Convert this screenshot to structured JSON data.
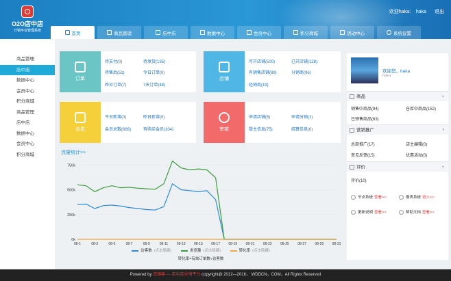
{
  "header": {
    "logo_title": "O2O店中店",
    "logo_subtitle": "分销平台管理系统",
    "welcome": "欢迎haka:",
    "username": "haka",
    "logout": "退出",
    "tabs": [
      {
        "label": "首页",
        "active": true
      },
      {
        "label": "商品管理"
      },
      {
        "label": "店中店"
      },
      {
        "label": "数据中心"
      },
      {
        "label": "会员中心"
      },
      {
        "label": "积分商城"
      },
      {
        "label": "活动中心"
      },
      {
        "label": "系统设置"
      }
    ]
  },
  "sidebar": {
    "items": [
      {
        "label": "商品管理"
      },
      {
        "label": "店中店",
        "active": true
      },
      {
        "label": "数据中心"
      },
      {
        "label": "会员中心"
      },
      {
        "label": "积分商城"
      },
      {
        "label": "商品管理"
      },
      {
        "label": "店中店"
      },
      {
        "label": "数据中心"
      },
      {
        "label": "会员中心"
      },
      {
        "label": "积分商城"
      }
    ]
  },
  "cards": {
    "order": {
      "title": "订单",
      "color": "#6ac5c4",
      "links": [
        "待支付(0)",
        "待发货(135)",
        "待售后(51)",
        "今日订单(0)",
        "昨日订单(7)",
        "7天订单(48)"
      ]
    },
    "store": {
      "title": "店铺",
      "color": "#4fb6e5",
      "links": [
        "可开店铺(500)",
        "已开店铺(128)",
        "有销售店铺(89)",
        "分销商(96)",
        "经销商(19)"
      ]
    },
    "member": {
      "title": "会员",
      "color": "#f5d03a",
      "links": [
        "今日新增(0)",
        "昨日新增(0)",
        "会员总数(666)",
        "有购买会员(104)"
      ]
    },
    "audit": {
      "title": "审核",
      "color": "#f26a6a",
      "links": [
        "申请店铺(5)",
        "申请分销(1)",
        "提主信息(75)",
        "结算信息(0)"
      ]
    }
  },
  "chart": {
    "section_title": "流量统计>>",
    "legend": [
      {
        "name": "访客数",
        "hint": "(点击隐藏)",
        "color": "#2a8bd6"
      },
      {
        "name": "浏览量",
        "hint": "(点击隐藏)",
        "color": "#3a9b3a"
      },
      {
        "name": "转化率",
        "hint": "(点击隐藏)",
        "color": "#f2a93b"
      }
    ],
    "formula": "转化率=有效订单数÷访客数"
  },
  "chart_data": {
    "type": "line",
    "ylim": [
      0,
      800000
    ],
    "y_ticks": [
      "0k",
      "250k",
      "500k",
      "750k"
    ],
    "x_ticks": [
      "08-1",
      "08-3",
      "08-5",
      "08-7",
      "08-9",
      "08-11",
      "08-13",
      "08-15",
      "08-17",
      "08-19",
      "08-21",
      "08-23",
      "08-25",
      "08-27",
      "08-29",
      "08-31"
    ],
    "series": [
      {
        "name": "访客数",
        "values": [
          350000,
          355000,
          310000,
          340000,
          345000,
          335000,
          320000,
          310000,
          300000,
          295000,
          330000,
          560000,
          500000,
          490000,
          480000,
          490000,
          400000,
          0,
          0,
          0,
          0,
          0,
          0,
          0,
          0,
          0,
          0,
          0,
          0,
          0,
          0
        ]
      },
      {
        "name": "浏览量",
        "values": [
          550000,
          540000,
          480000,
          520000,
          540000,
          520000,
          525000,
          515000,
          510000,
          505000,
          560000,
          790000,
          720000,
          700000,
          710000,
          700000,
          620000,
          0,
          0,
          0,
          0,
          0,
          0,
          0,
          0,
          0,
          0,
          0,
          0,
          0,
          0
        ]
      },
      {
        "name": "转化率",
        "values": [
          0,
          0,
          0,
          0,
          0,
          0,
          0,
          0,
          0,
          0,
          0,
          0,
          0,
          0,
          0,
          0,
          0,
          0,
          0,
          0,
          0,
          0,
          0,
          0,
          0,
          0,
          0,
          0,
          0,
          0,
          0
        ]
      }
    ]
  },
  "right": {
    "welcome": "欢迎您，haka",
    "username": "haka",
    "goods_title": "商品",
    "goods_links": [
      "销售中商品(94)",
      "仓库中商品(152)",
      "已预售商品(63)"
    ],
    "promo_title": "营销推广",
    "promo_links": [
      "总部推广(17)",
      "店主编辑(0)",
      "意见反馈(15)",
      "优惠活动(0)"
    ],
    "review_title": "评价",
    "review_links": [
      "评价(10)"
    ],
    "tools": [
      {
        "label": "节点系统",
        "action": "查看>>"
      },
      {
        "label": "报表系统",
        "action": "进入>>"
      },
      {
        "label": "更新说明",
        "action": "查看>>"
      },
      {
        "label": "帮助文档",
        "action": "查看>>"
      }
    ]
  },
  "footer": {
    "powered": "Powered by",
    "brand": "资源客 — 店中店分销平台",
    "copyright": "copyright@ 2012—2016， WDDCN，COM，All Rights Reserved"
  }
}
